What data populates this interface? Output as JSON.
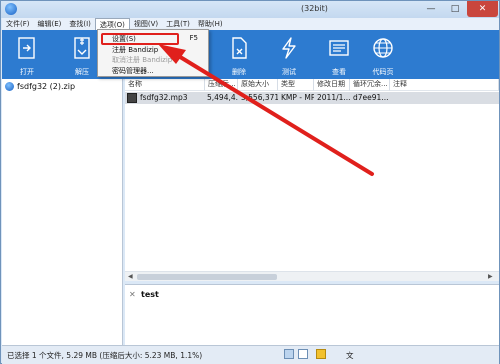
{
  "window": {
    "title": "(32bit)"
  },
  "menubar": {
    "items": [
      "文件(F)",
      "编辑(E)",
      "查找(I)",
      "选项(O)",
      "视图(V)",
      "工具(T)",
      "帮助(H)"
    ]
  },
  "toolbar": {
    "items": [
      {
        "label": "打开",
        "icon": "open-icon"
      },
      {
        "label": "解压",
        "icon": "extract-icon"
      },
      {
        "label": "删除",
        "icon": "delete-icon"
      },
      {
        "label": "测试",
        "icon": "test-icon"
      },
      {
        "label": "查看",
        "icon": "view-icon"
      },
      {
        "label": "代码页",
        "icon": "codepage-icon"
      }
    ]
  },
  "dropdown": {
    "items": [
      {
        "label": "设置(S)",
        "shortcut": "F5",
        "disabled": false
      },
      {
        "label": "注册 Bandizip",
        "shortcut": "",
        "disabled": false
      },
      {
        "label": "取消注册 Bandizip",
        "shortcut": "",
        "disabled": true
      },
      {
        "label": "密码管理器...",
        "shortcut": "",
        "disabled": false
      }
    ]
  },
  "tree": {
    "root": "fsdfg32 (2).zip"
  },
  "filelist": {
    "columns": [
      "名称",
      "压缩后...",
      "原始大小",
      "类型",
      "修改日期",
      "循环冗余...",
      "注释"
    ],
    "rows": [
      {
        "name": "fsdfg32.mp3",
        "compressed": "5,494,4...",
        "original": "5,556,371",
        "type": "KMP - MP...",
        "modified": "2011/1...",
        "crc": "d7ee91...",
        "comment": ""
      }
    ]
  },
  "comment": {
    "text": "test"
  },
  "statusbar": {
    "text": "已选择 1 个文件, 5.29 MB (压缩后大小: 5.23 MB, 1.1%)",
    "char": "文"
  },
  "colors": {
    "toolbar": "#2d7bd0",
    "highlight": "#e0201c",
    "arrow": "#e0201c"
  }
}
